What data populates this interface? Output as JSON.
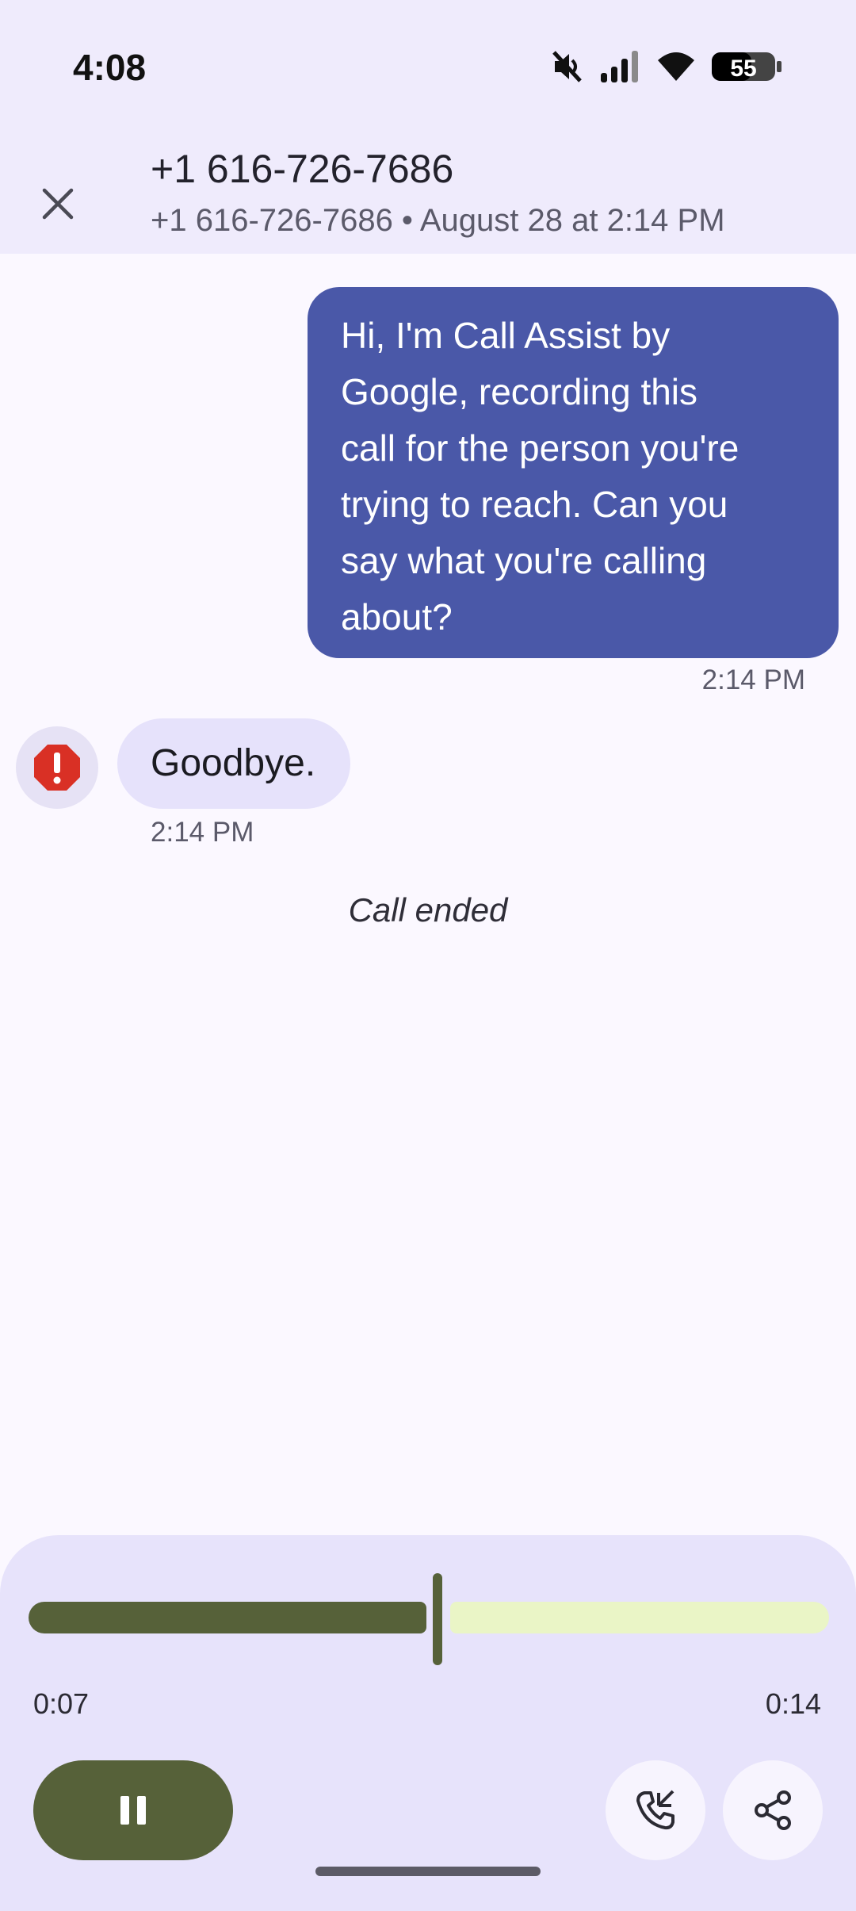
{
  "status_bar": {
    "time": "4:08",
    "battery": "55",
    "icons": [
      "mute-icon",
      "signal-icon",
      "wifi-icon",
      "battery-icon"
    ]
  },
  "header": {
    "title": "+1 616-726-7686",
    "subtitle": "+1 616-726-7686 • August 28 at 2:14 PM",
    "close_icon": "close-icon"
  },
  "messages": [
    {
      "direction": "outgoing",
      "lines": [
        "Hi, I'm Call Assist by",
        "Google, recording this",
        "call for the person you're",
        "trying to reach. Can you",
        "say what you're calling",
        "about?"
      ],
      "time": "2:14 PM"
    },
    {
      "direction": "incoming",
      "text": "Goodbye.",
      "time": "2:14 PM",
      "avatar_icon": "spam-warning-icon"
    }
  ],
  "call_status": "Call ended",
  "player": {
    "current_time": "0:07",
    "total_time": "0:14",
    "progress": 0.5,
    "pause_icon": "pause-icon",
    "callback_icon": "phone-callback-icon",
    "share_icon": "share-icon"
  },
  "colors": {
    "accent": "#4a58a8",
    "player_accent": "#566139",
    "warning": "#d93025"
  }
}
